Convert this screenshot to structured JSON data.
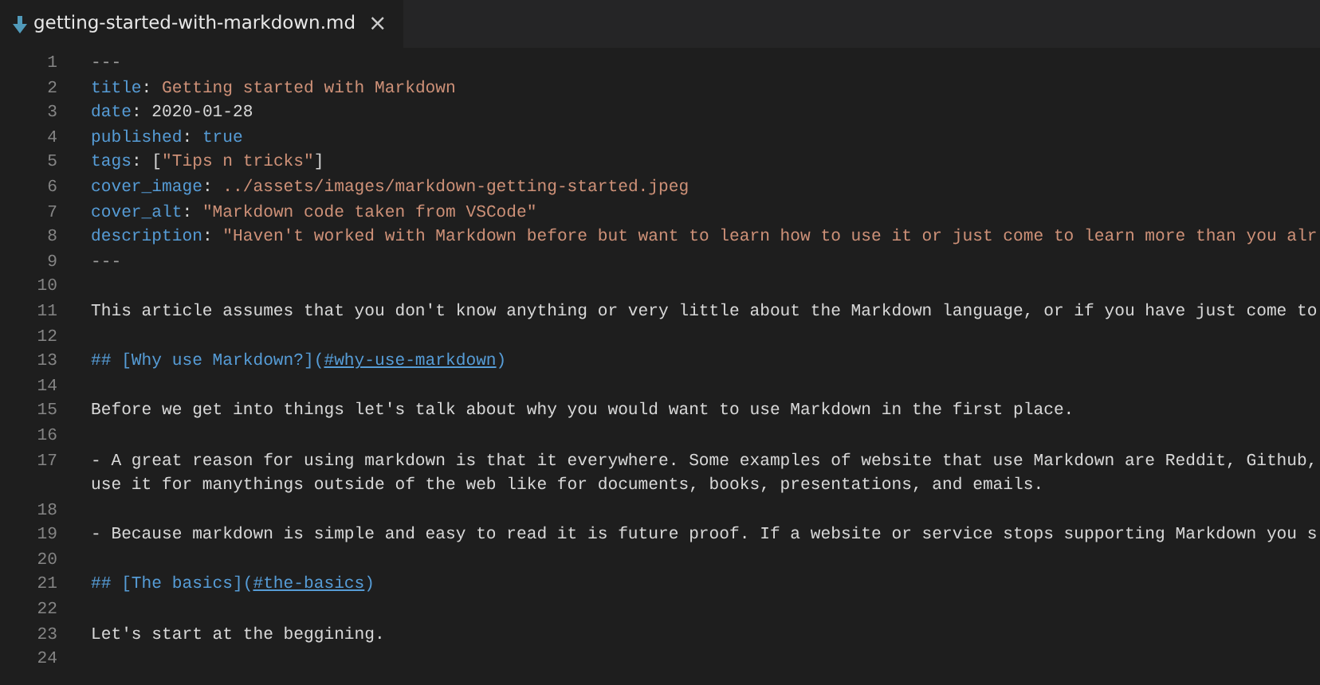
{
  "tab": {
    "file_name": "getting-started-with-markdown.md",
    "close": "×",
    "selected": true
  },
  "lines": [
    {
      "number": "1",
      "segments": [
        {
          "kind": "dashes",
          "text": "---"
        }
      ]
    },
    {
      "number": "2",
      "segments": [
        {
          "kind": "key",
          "text": "title"
        },
        {
          "kind": "punct",
          "text": ": "
        },
        {
          "kind": "string",
          "text": "Getting started with Markdown"
        }
      ]
    },
    {
      "number": "3",
      "segments": [
        {
          "kind": "key",
          "text": "date"
        },
        {
          "kind": "punct",
          "text": ": "
        },
        {
          "kind": "plain",
          "text": "2020-01-28"
        }
      ]
    },
    {
      "number": "4",
      "segments": [
        {
          "kind": "key",
          "text": "published"
        },
        {
          "kind": "punct",
          "text": ": "
        },
        {
          "kind": "boolean",
          "text": "true"
        }
      ]
    },
    {
      "number": "5",
      "segments": [
        {
          "kind": "key",
          "text": "tags"
        },
        {
          "kind": "punct",
          "text": ": ["
        },
        {
          "kind": "string",
          "text": "\"Tips n tricks\""
        },
        {
          "kind": "punct",
          "text": "]"
        }
      ]
    },
    {
      "number": "6",
      "segments": [
        {
          "kind": "key",
          "text": "cover_image"
        },
        {
          "kind": "punct",
          "text": ": "
        },
        {
          "kind": "string",
          "text": "../assets/images/markdown-getting-started.jpeg"
        }
      ]
    },
    {
      "number": "7",
      "segments": [
        {
          "kind": "key",
          "text": "cover_alt"
        },
        {
          "kind": "punct",
          "text": ": "
        },
        {
          "kind": "string",
          "text": "\"Markdown code taken from VSCode\""
        }
      ]
    },
    {
      "number": "8",
      "segments": [
        {
          "kind": "key",
          "text": "description"
        },
        {
          "kind": "punct",
          "text": ": "
        },
        {
          "kind": "string",
          "text": "\"Haven't worked with Markdown before but want to learn how to use it or just come to learn more than you alr"
        }
      ]
    },
    {
      "number": "9",
      "segments": [
        {
          "kind": "dashes",
          "text": "---"
        }
      ]
    },
    {
      "number": "10"
    },
    {
      "number": "11",
      "segments": [
        {
          "kind": "plain",
          "text": "This article assumes that you don't know anything or very little about the Markdown language, or if you have just come to"
        }
      ]
    },
    {
      "number": "12"
    },
    {
      "number": "13",
      "segments": [
        {
          "kind": "heading",
          "text": "## [Why use Markdown?]("
        },
        {
          "kind": "link",
          "text": "#why-use-markdown"
        },
        {
          "kind": "heading",
          "text": ")"
        }
      ]
    },
    {
      "number": "14"
    },
    {
      "number": "15",
      "segments": [
        {
          "kind": "plain",
          "text": "Before we get into things let's talk about why you would want to use Markdown in the first place."
        }
      ]
    },
    {
      "number": "16"
    },
    {
      "number": "17",
      "segments": [
        {
          "kind": "plain",
          "text": "- A great reason for using markdown is that it everywhere. Some examples of website that use Markdown are Reddit, Github,"
        }
      ],
      "continuation": [
        {
          "kind": "plain",
          "text": "use it for manythings outside of the web like for documents, books, presentations, and emails."
        }
      ]
    },
    {
      "number": "18"
    },
    {
      "number": "19",
      "segments": [
        {
          "kind": "plain",
          "text": "- Because markdown is simple and easy to read it is future proof. If a website or service stops supporting Markdown you s"
        }
      ]
    },
    {
      "number": "20"
    },
    {
      "number": "21",
      "segments": [
        {
          "kind": "heading",
          "text": "## [The basics]("
        },
        {
          "kind": "link",
          "text": "#the-basics"
        },
        {
          "kind": "heading",
          "text": ")"
        }
      ]
    },
    {
      "number": "22"
    },
    {
      "number": "23",
      "segments": [
        {
          "kind": "plain",
          "text": "Let's start at the beggining."
        }
      ]
    },
    {
      "number": "24"
    }
  ]
}
